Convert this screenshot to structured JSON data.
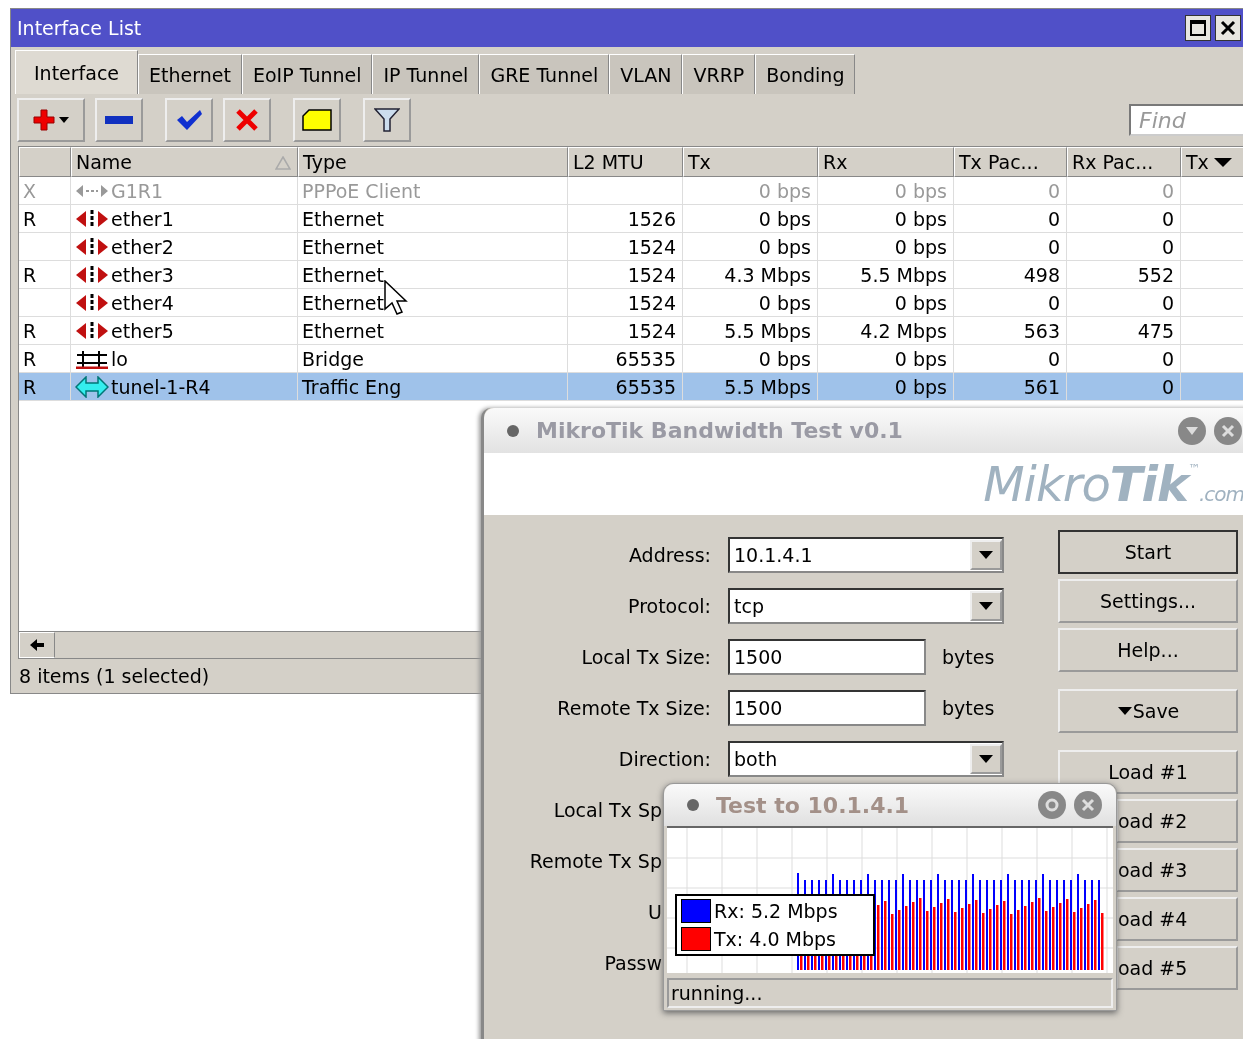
{
  "interface_list": {
    "title": "Interface List",
    "tabs": [
      {
        "label": "Interface",
        "selected": true
      },
      {
        "label": "Ethernet",
        "selected": false
      },
      {
        "label": "EoIP Tunnel",
        "selected": false
      },
      {
        "label": "IP Tunnel",
        "selected": false
      },
      {
        "label": "GRE Tunnel",
        "selected": false
      },
      {
        "label": "VLAN",
        "selected": false
      },
      {
        "label": "VRRP",
        "selected": false
      },
      {
        "label": "Bonding",
        "selected": false
      }
    ],
    "toolbar": [
      {
        "kind": "add"
      },
      {
        "kind": "remove"
      },
      {
        "kind": "enable"
      },
      {
        "kind": "disable"
      },
      {
        "kind": "comment"
      },
      {
        "kind": "filter"
      }
    ],
    "search": {
      "placeholder": "Find"
    },
    "columns": [
      "Name",
      "Type",
      "L2 MTU",
      "Tx",
      "Rx",
      "Tx Pac...",
      "Rx Pac...",
      "Tx"
    ],
    "rows": [
      {
        "flag": "X",
        "kind": "pppoe",
        "name": "G1R1",
        "type": "PPPoE Client",
        "tx": "0 bps",
        "rx": "0 bps",
        "tx_packets": "0",
        "rx_packets": "0",
        "disabled": true,
        "selected": false
      },
      {
        "flag": "R",
        "kind": "ethernet",
        "name": "ether1",
        "type": "Ethernet",
        "l2mtu": "1526",
        "tx": "0 bps",
        "rx": "0 bps",
        "tx_packets": "0",
        "rx_packets": "0",
        "disabled": false,
        "selected": false
      },
      {
        "kind": "ethernet",
        "name": "ether2",
        "type": "Ethernet",
        "l2mtu": "1524",
        "tx": "0 bps",
        "rx": "0 bps",
        "tx_packets": "0",
        "rx_packets": "0",
        "disabled": false,
        "selected": false
      },
      {
        "flag": "R",
        "kind": "ethernet",
        "name": "ether3",
        "type": "Ethernet",
        "l2mtu": "1524",
        "tx": "4.3 Mbps",
        "rx": "5.5 Mbps",
        "tx_packets": "498",
        "rx_packets": "552",
        "disabled": false,
        "selected": false
      },
      {
        "kind": "ethernet",
        "name": "ether4",
        "type": "Ethernet",
        "l2mtu": "1524",
        "tx": "0 bps",
        "rx": "0 bps",
        "tx_packets": "0",
        "rx_packets": "0",
        "disabled": false,
        "selected": false
      },
      {
        "flag": "R",
        "kind": "ethernet",
        "name": "ether5",
        "type": "Ethernet",
        "l2mtu": "1524",
        "tx": "5.5 Mbps",
        "rx": "4.2 Mbps",
        "tx_packets": "563",
        "rx_packets": "475",
        "disabled": false,
        "selected": false
      },
      {
        "flag": "R",
        "kind": "bridge",
        "name": "lo",
        "type": "Bridge",
        "l2mtu": "65535",
        "tx": "0 bps",
        "rx": "0 bps",
        "tx_packets": "0",
        "rx_packets": "0",
        "disabled": false,
        "selected": false
      },
      {
        "flag": "R",
        "kind": "tunnel",
        "name": "tunel-1-R4",
        "type": "Traffic Eng",
        "l2mtu": "65535",
        "tx": "5.5 Mbps",
        "rx": "0 bps",
        "tx_packets": "561",
        "rx_packets": "0",
        "disabled": false,
        "selected": true
      }
    ],
    "status": "8 items (1 selected)"
  },
  "bandwidth_test": {
    "title": "MikroTik Bandwidth Test v0.1",
    "logo": {
      "text": "Mikro**Tik**",
      "mark": "™",
      "suffix": ".com"
    },
    "fields": [
      {
        "label": "Address:",
        "kind": "select",
        "value": "10.1.4.1"
      },
      {
        "label": "Protocol:",
        "kind": "select",
        "value": "tcp"
      },
      {
        "label": "Local Tx Size:",
        "kind": "input",
        "value": "1500",
        "unit": "bytes"
      },
      {
        "label": "Remote Tx Size:",
        "kind": "input",
        "value": "1500",
        "unit": "bytes"
      },
      {
        "label": "Direction:",
        "kind": "select",
        "value": "both"
      },
      {
        "label": "Local Tx Sp",
        "kind": "covered"
      },
      {
        "label": "Remote Tx Sp",
        "kind": "covered"
      },
      {
        "label": "U",
        "kind": "covered"
      },
      {
        "label": "Passw",
        "kind": "covered"
      }
    ],
    "buttons": [
      {
        "label": "Start",
        "kind": "default"
      },
      {
        "label": "Settings...",
        "kind": "plain"
      },
      {
        "label": "Help...",
        "kind": "plain"
      },
      {
        "label": "Save",
        "kind": "menu"
      },
      {
        "label": "Load #1",
        "kind": "plain"
      },
      {
        "label": "oad #2",
        "kind": "covered"
      },
      {
        "label": "oad #3",
        "kind": "covered"
      },
      {
        "label": "oad #4",
        "kind": "covered"
      },
      {
        "label": "oad #5",
        "kind": "covered"
      }
    ]
  },
  "test_window": {
    "title": "Test to 10.1.4.1",
    "legend": [
      {
        "label": "Rx: 5.2 Mbps",
        "color": "#0000ff"
      },
      {
        "label": "Tx: 4.0 Mbps",
        "color": "#ff0000"
      }
    ],
    "status": "running..."
  }
}
